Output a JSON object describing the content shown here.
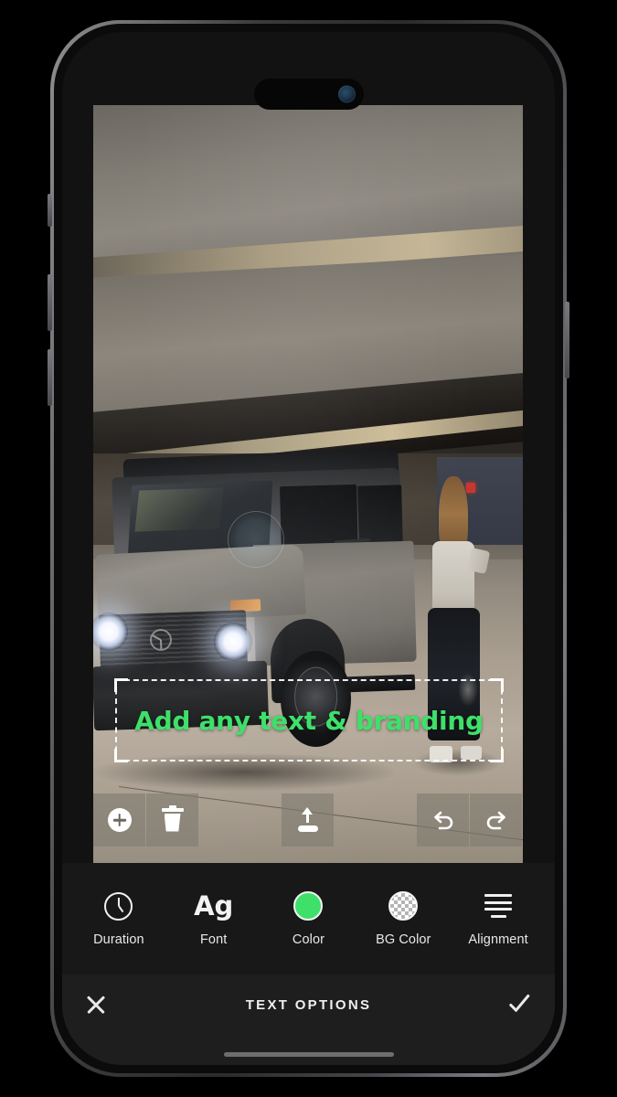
{
  "screen": {
    "status_bar": {
      "dynamic_island": "dynamic-island",
      "camera": "front-camera-lens"
    },
    "home_indicator": "home-indicator"
  },
  "photo": {
    "description": "Gray Mercedes-Benz G-Class SUV with headlights on, parked in a concrete parking garage; a woman in a cream top and black pants stands beside the open driver door.",
    "alt": "parking garage SUV photo"
  },
  "text_overlay": {
    "value": "Add any text & branding",
    "color": "#3ee06a",
    "selected": true,
    "alignment": "center"
  },
  "float_toolbar": {
    "buttons": [
      {
        "name": "add-text-button",
        "icon": "plus-icon",
        "label": "Add"
      },
      {
        "name": "delete-button",
        "icon": "trash-icon",
        "label": "Delete"
      },
      {
        "name": "export-button",
        "icon": "export-icon",
        "label": "Export"
      },
      {
        "name": "undo-button",
        "icon": "undo-icon",
        "label": "Undo"
      },
      {
        "name": "redo-button",
        "icon": "redo-icon",
        "label": "Redo"
      }
    ]
  },
  "options": {
    "items": [
      {
        "label": "Duration",
        "icon": "clock-icon",
        "value": ""
      },
      {
        "label": "Font",
        "icon": "font-ag-icon",
        "value": "Ag"
      },
      {
        "label": "Color",
        "icon": "color-swatch-icon",
        "value": "#3ee06a"
      },
      {
        "label": "BG Color",
        "icon": "transparent-checkerboard-icon",
        "value": "transparent"
      },
      {
        "label": "Alignment",
        "icon": "align-center-icon",
        "value": "center"
      }
    ]
  },
  "action_bar": {
    "close_label": "",
    "title": "TEXT OPTIONS",
    "confirm_label": ""
  },
  "colors": {
    "accent_green": "#3ee06a",
    "bar_background": "#181818",
    "action_bar_background": "#1e1e1e",
    "text_primary": "#e8e8e8"
  }
}
